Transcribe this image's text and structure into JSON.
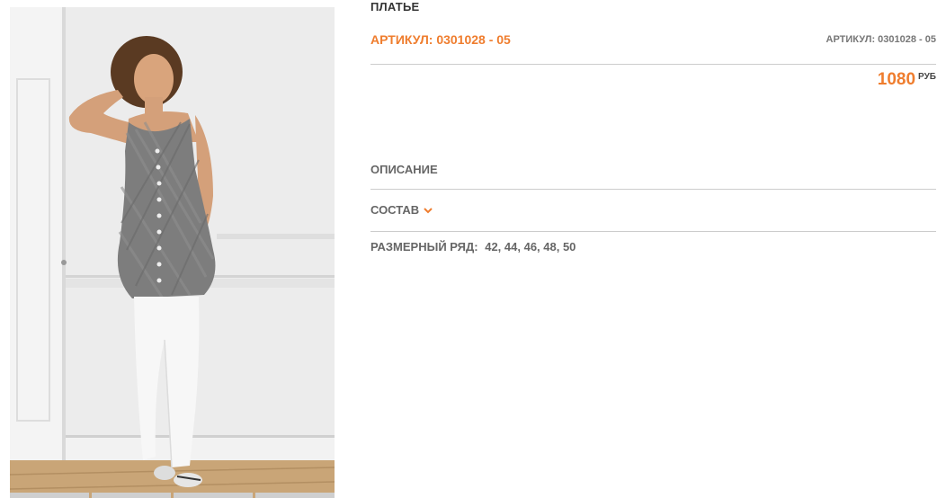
{
  "product": {
    "title": "ПЛАТЬЕ",
    "sku_main": "АРТИКУЛ: 0301028 - 05",
    "sku_side": "АРТИКУЛ: 0301028 - 05",
    "price_value": "1080",
    "price_currency": "РУБ"
  },
  "sections": {
    "description_label": "ОПИСАНИЕ",
    "composition_label": "СОСТАВ",
    "sizes_label": "РАЗМЕРНЫЙ РЯД:",
    "sizes_value": "42, 44, 46, 48, 50"
  },
  "icons": {
    "composition_toggle": "chevron-down-icon"
  },
  "colors": {
    "accent": "#ef7d2e",
    "title": "#333333",
    "label": "#666666",
    "rule": "#cccccc"
  }
}
